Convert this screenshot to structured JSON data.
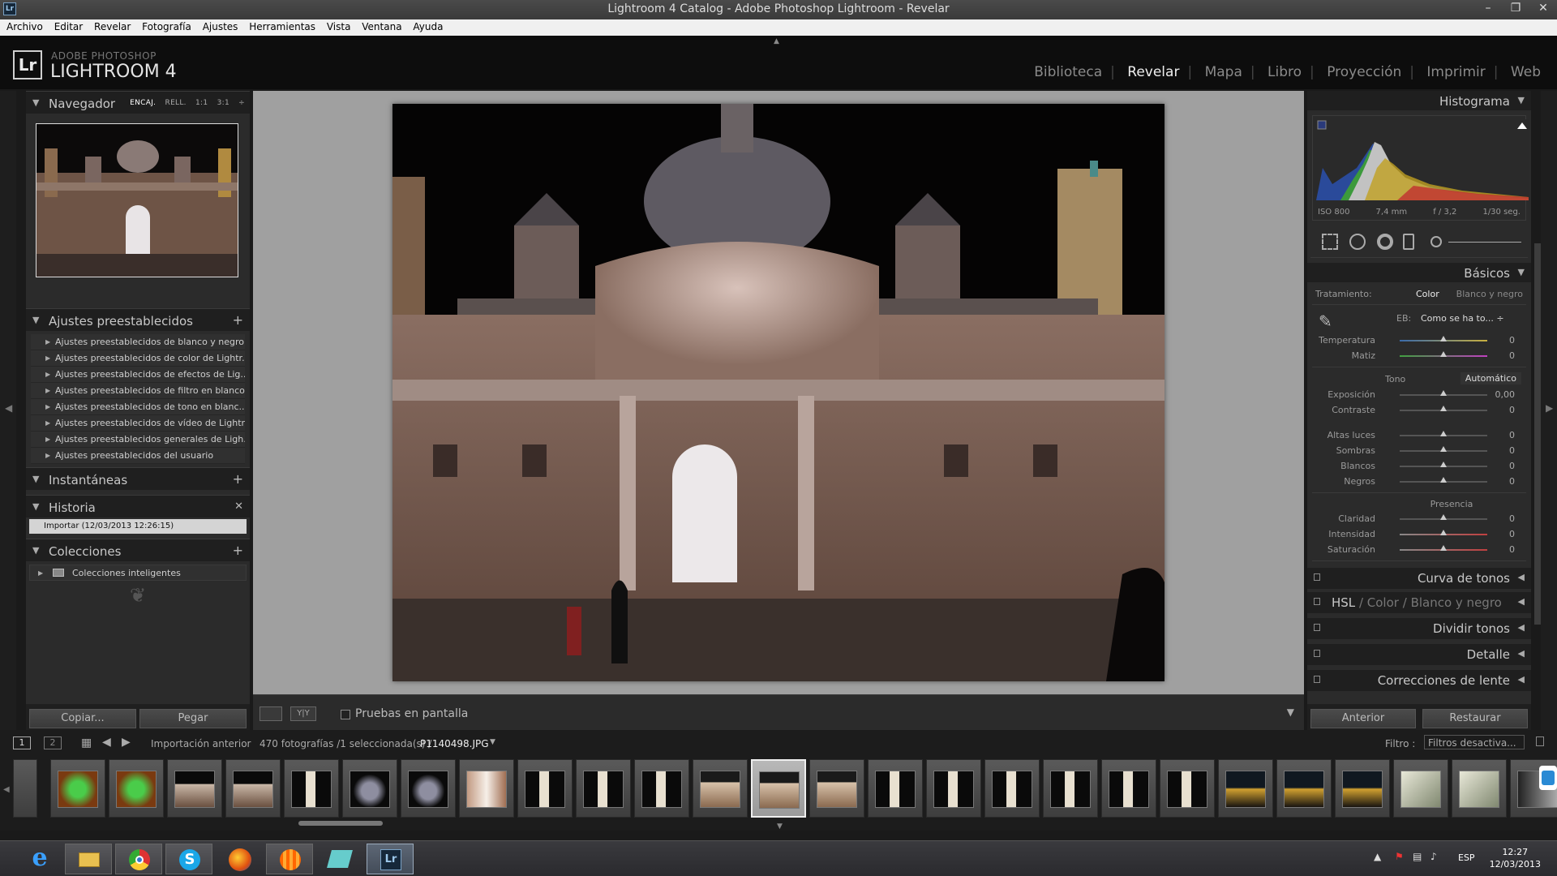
{
  "window": {
    "title": "Lightroom 4 Catalog - Adobe Photoshop Lightroom - Revelar",
    "app_icon": "Lr"
  },
  "menu": [
    "Archivo",
    "Editar",
    "Revelar",
    "Fotografía",
    "Ajustes",
    "Herramientas",
    "Vista",
    "Ventana",
    "Ayuda"
  ],
  "brand": {
    "logo": "Lr",
    "line1": "ADOBE PHOTOSHOP",
    "line2": "LIGHTROOM 4"
  },
  "modules": [
    "Biblioteca",
    "Revelar",
    "Mapa",
    "Libro",
    "Proyección",
    "Imprimir",
    "Web"
  ],
  "active_module": "Revelar",
  "left": {
    "navigator": {
      "title": "Navegador",
      "options": [
        "ENCAJ.",
        "RELL.",
        "1:1",
        "3:1"
      ]
    },
    "presets": {
      "title": "Ajustes preestablecidos",
      "items": [
        "Ajustes preestablecidos de blanco y negro...",
        "Ajustes preestablecidos de color de Lightr...",
        "Ajustes preestablecidos de efectos de Lig...",
        "Ajustes preestablecidos de filtro en blanco...",
        "Ajustes preestablecidos de tono en blanc...",
        "Ajustes preestablecidos de vídeo de Lightr...",
        "Ajustes preestablecidos generales de Ligh...",
        "Ajustes preestablecidos del usuario"
      ]
    },
    "snapshots": {
      "title": "Instantáneas"
    },
    "history": {
      "title": "Historia",
      "items": [
        "Importar (12/03/2013 12:26:15)"
      ]
    },
    "collections": {
      "title": "Colecciones",
      "items": [
        "Colecciones inteligentes"
      ]
    },
    "copy_btn": "Copiar...",
    "paste_btn": "Pegar"
  },
  "toolbar": {
    "view_label": "Y|Y",
    "softproof": "Pruebas en pantalla"
  },
  "right": {
    "histogram": {
      "title": "Histograma",
      "iso": "ISO 800",
      "focal": "7,4 mm",
      "aperture": "f / 3,2",
      "shutter": "1/30 seg."
    },
    "basics": {
      "title": "Básicos",
      "treatment_label": "Tratamiento:",
      "treatment_color": "Color",
      "treatment_bw": "Blanco y negro",
      "wb_label": "EB:",
      "wb_value": "Como se ha to... ÷",
      "wb_sliders": [
        {
          "label": "Temperatura",
          "value": "0"
        },
        {
          "label": "Matiz",
          "value": "0"
        }
      ],
      "tone_label": "Tono",
      "tone_auto": "Automático",
      "tone_sliders": [
        {
          "label": "Exposición",
          "value": "0,00"
        },
        {
          "label": "Contraste",
          "value": "0"
        }
      ],
      "light_sliders": [
        {
          "label": "Altas luces",
          "value": "0"
        },
        {
          "label": "Sombras",
          "value": "0"
        },
        {
          "label": "Blancos",
          "value": "0"
        },
        {
          "label": "Negros",
          "value": "0"
        }
      ],
      "presence_label": "Presencia",
      "presence_sliders": [
        {
          "label": "Claridad",
          "value": "0"
        },
        {
          "label": "Intensidad",
          "value": "0"
        },
        {
          "label": "Saturación",
          "value": "0"
        }
      ]
    },
    "panels": [
      "Curva de tonos",
      "Dividir tonos",
      "Detalle",
      "Correcciones de lente"
    ],
    "hsl": {
      "hsl": "HSL",
      "color": "Color",
      "bw": "Blanco y negro"
    },
    "prev_btn": "Anterior",
    "reset_btn": "Restaurar"
  },
  "filmstrip": {
    "page1": "1",
    "page2": "2",
    "source": "Importación anterior",
    "count": "470 fotografías /1 seleccionada(s) /",
    "filename": "P1140498.JPG",
    "filter_label": "Filtro :",
    "filter_value": "Filtros desactiva...",
    "thumbs": [
      "toy",
      "toy",
      "cathedral",
      "cathedral",
      "tower",
      "dome",
      "dome",
      "blur",
      "tower",
      "tower",
      "tower",
      "cathedral-wide",
      "cathedral-wide",
      "cathedral-wide",
      "tower",
      "tower",
      "tower",
      "tower",
      "tower",
      "tower",
      "night",
      "night",
      "night",
      "white",
      "white",
      "partial"
    ],
    "selected_index": 12
  },
  "taskbar": {
    "lang": "ESP",
    "time": "12:27",
    "date": "12/03/2013",
    "apps": [
      "ie",
      "explorer",
      "chrome",
      "skype",
      "firefox",
      "app",
      "app2",
      "lightroom"
    ]
  },
  "colors": {
    "accent": "#eeeeee",
    "panel": "#2b2b2b",
    "center_bg": "#a0a0a0"
  }
}
